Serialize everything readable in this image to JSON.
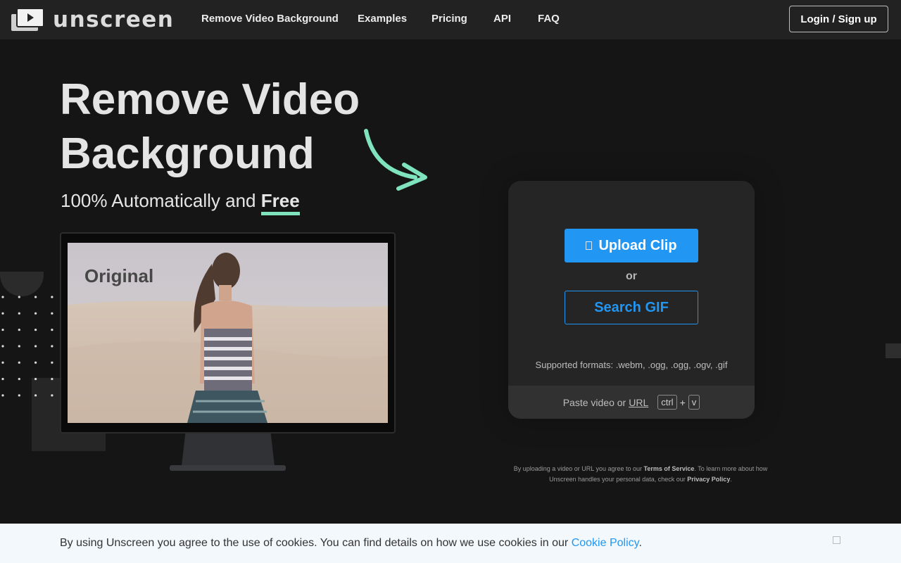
{
  "header": {
    "logo_text": "unscreen",
    "nav": [
      {
        "label": "Remove Video Background"
      },
      {
        "label": "Examples"
      },
      {
        "label": "Pricing"
      },
      {
        "label": "API"
      },
      {
        "label": "FAQ"
      }
    ],
    "login_label": "Login / Sign up"
  },
  "hero": {
    "title_line1": "Remove Video",
    "title_line2": "Background",
    "subtitle_prefix": "100% Automatically and",
    "subtitle_emphasis": "Free",
    "screen_label": "Original"
  },
  "upload": {
    "upload_label": "Upload Clip",
    "or_text": "or",
    "search_gif_label": "Search GIF",
    "supported_formats": "Supported formats: .webm, .ogg, .ogg, .ogv, .gif",
    "paste_prefix": "Paste video or",
    "paste_url": "URL",
    "key_ctrl": "ctrl",
    "key_plus": "+",
    "key_v": "v"
  },
  "terms": {
    "part1": "By uploading a video or URL you agree to our",
    "tos": "Terms of Service",
    "part2": ". To learn more about how Unscreen handles your personal data, check our",
    "privacy": "Privacy Policy",
    "part3": "."
  },
  "cookie": {
    "text": "By using Unscreen you agree to the use of cookies. You can find details on how we use cookies in our",
    "link": "Cookie Policy",
    "end": "."
  },
  "colors": {
    "accent_blue": "#2196f3",
    "accent_green": "#7fe3bd",
    "background": "#151515"
  }
}
